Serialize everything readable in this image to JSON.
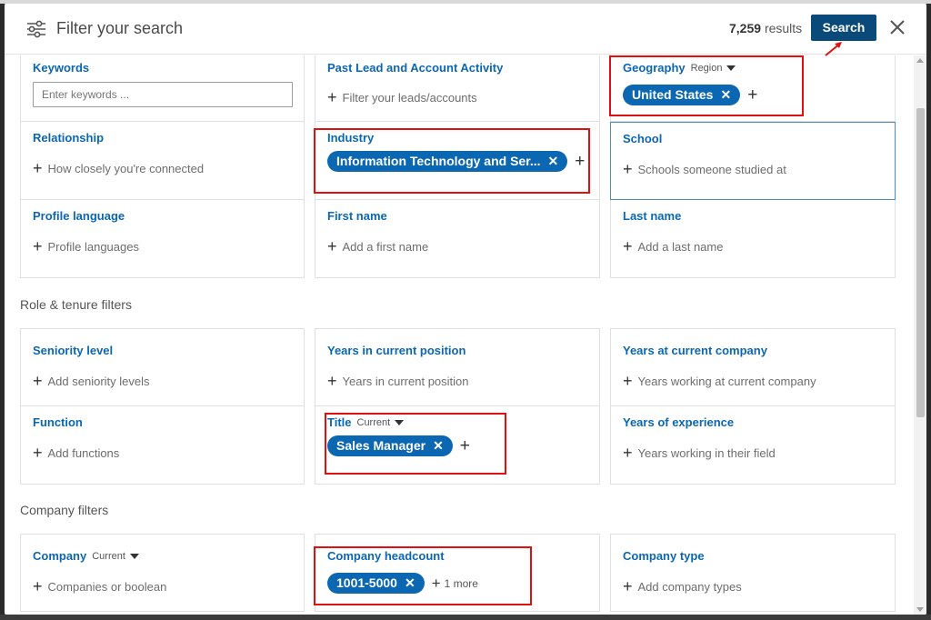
{
  "header": {
    "title": "Filter your search",
    "results_count": "7,259",
    "results_label": "results",
    "search_label": "Search",
    "close_icon": "close-icon"
  },
  "grid1": {
    "keywords": {
      "label": "Keywords",
      "placeholder": "Enter keywords ..."
    },
    "past_lead": {
      "label": "Past Lead and Account Activity",
      "add_text": "Filter your leads/accounts"
    },
    "geography": {
      "label": "Geography",
      "selector": "Region",
      "pill": "United States"
    },
    "relationship": {
      "label": "Relationship",
      "add_text": "How closely you're connected"
    },
    "industry": {
      "label": "Industry",
      "pill": "Information Technology and Ser..."
    },
    "school": {
      "label": "School",
      "add_text": "Schools someone studied at"
    },
    "profile_language": {
      "label": "Profile language",
      "add_text": "Profile languages"
    },
    "first_name": {
      "label": "First name",
      "add_text": "Add a first name"
    },
    "last_name": {
      "label": "Last name",
      "add_text": "Add a last name"
    }
  },
  "role_section": {
    "title": "Role & tenure filters"
  },
  "grid2": {
    "seniority": {
      "label": "Seniority level",
      "add_text": "Add seniority levels"
    },
    "years_position": {
      "label": "Years in current position",
      "add_text": "Years in current position"
    },
    "years_company": {
      "label": "Years at current company",
      "add_text": "Years working at current company"
    },
    "function": {
      "label": "Function",
      "add_text": "Add functions"
    },
    "title": {
      "label": "Title",
      "selector": "Current",
      "pill": "Sales Manager"
    },
    "years_experience": {
      "label": "Years of experience",
      "add_text": "Years working in their field"
    }
  },
  "company_section": {
    "title": "Company filters"
  },
  "grid3": {
    "company": {
      "label": "Company",
      "selector": "Current",
      "add_text": "Companies or boolean"
    },
    "headcount": {
      "label": "Company headcount",
      "pill": "1001-5000",
      "more": "1 more"
    },
    "company_type": {
      "label": "Company type",
      "add_text": "Add company types"
    }
  },
  "colors": {
    "accent": "#0b67b1",
    "button": "#0a4a7a",
    "annotation": "#e01010"
  }
}
